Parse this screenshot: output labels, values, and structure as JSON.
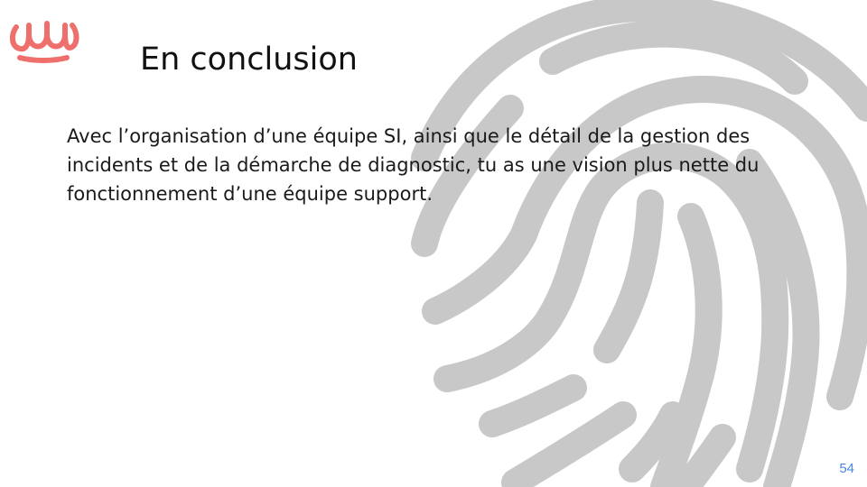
{
  "slide": {
    "title": "En conclusion",
    "body": "Avec l’organisation d’une équipe SI, ainsi que le détail de la gestion des incidents et de la démarche de diagnostic, tu as une vision plus nette du fonctionnement d’une équipe support.",
    "page_number": "54"
  },
  "icons": {
    "logo": "brand-logo-icon",
    "background": "fingerprint-icon"
  },
  "colors": {
    "logo": "#ef6f6c",
    "fingerprint": "#c8c8c8",
    "page_number": "#4a86e8"
  }
}
